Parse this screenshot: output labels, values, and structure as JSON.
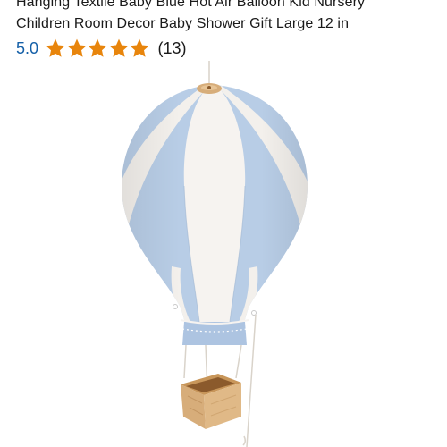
{
  "product": {
    "title_lines": [
      "Hanging Textile Baby Blue Hot Air Balloon Kid Nursery",
      "Children Room Decor Baby Shower Gift Large 12 in"
    ],
    "rating": {
      "value": "5.0",
      "stars_filled": 5,
      "stars_total": 5,
      "review_count": "(13)"
    },
    "image": {
      "subject": "hot-air-balloon-decoration",
      "colors": {
        "stripe_blue": "#b8cde6",
        "stripe_white": "#f6f3f0",
        "wood": "#d7ad7a"
      }
    }
  },
  "colors": {
    "star": "#e8850c",
    "rating_link": "#1560a8",
    "text": "#1a1a1a"
  }
}
